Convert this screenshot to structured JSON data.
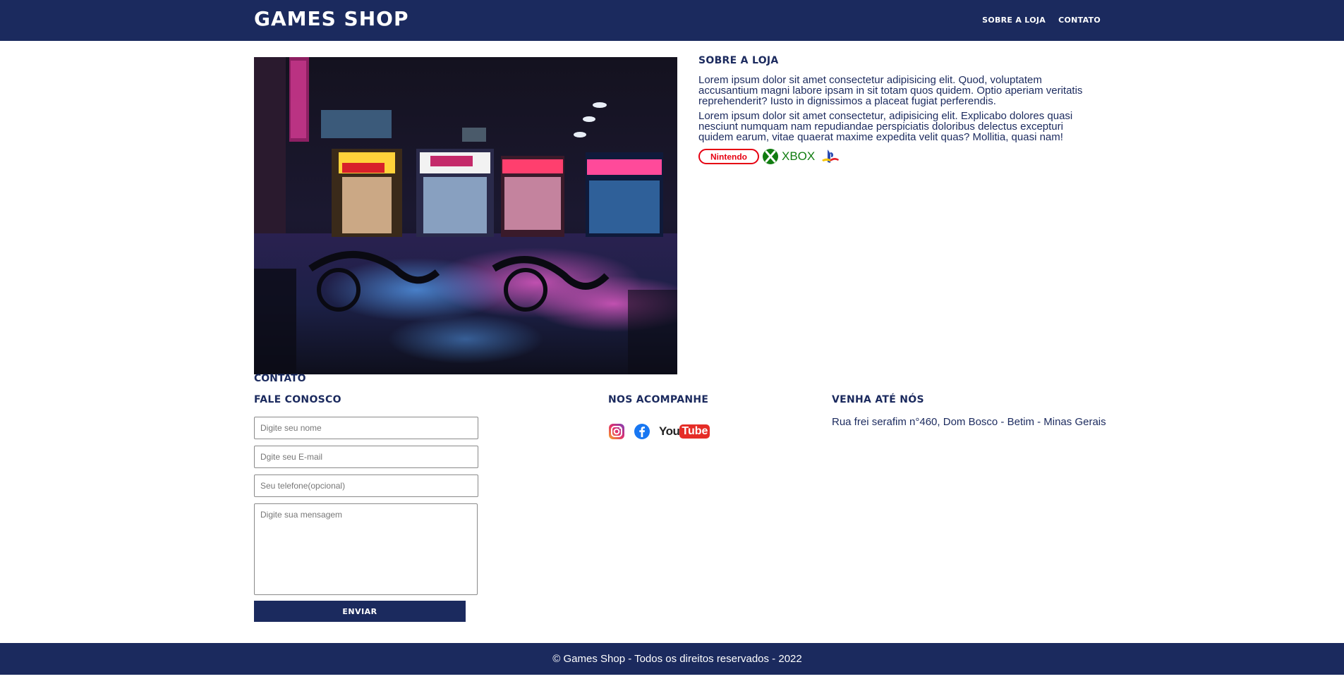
{
  "header": {
    "logo": "GAMES SHOP",
    "nav": [
      "SOBRE A LOJA",
      "CONTATO"
    ]
  },
  "about": {
    "title": "SOBRE A LOJA",
    "paragraphs": [
      "Lorem ipsum dolor sit amet consectetur adipisicing elit. Quod, voluptatem accusantium magni labore ipsam in sit totam quos quidem. Optio aperiam veritatis reprehenderit? Iusto in dignissimos a placeat fugiat perferendis.",
      "Lorem ipsum dolor sit amet consectetur, adipisicing elit. Explicabo dolores quasi nesciunt numquam nam repudiandae perspiciatis doloribus delectus excepturi quidem earum, vitae quaerat maxime expedita velit quas? Mollitia, quasi nam!"
    ],
    "brands": [
      "Nintendo",
      "XBOX"
    ]
  },
  "contact": {
    "section_title": "CONTATO",
    "form": {
      "title": "FALE CONOSCO",
      "name_placeholder": "Digite seu nome",
      "email_placeholder": "Dgite seu E-mail",
      "phone_placeholder": "Seu telefone(opcional)",
      "message_placeholder": "Digite sua mensagem",
      "submit_label": "ENVIAR"
    },
    "social": {
      "title": "NOS ACOMPANHE",
      "icons": [
        "instagram-icon",
        "facebook-icon",
        "youtube-icon"
      ],
      "youtube_text": "YouTube"
    },
    "location": {
      "title": "VENHA ATÉ NÓS",
      "address": "Rua frei serafim n°460, Dom Bosco - Betim - Minas Gerais"
    }
  },
  "footer": {
    "text": "© Games Shop - Todos os direitos reservados - 2022"
  },
  "colors": {
    "brand_navy": "#1b2a5e",
    "nintendo_red": "#e60012",
    "xbox_green": "#107c10",
    "playstation_blue": "#2a4cb2",
    "youtube_red": "#e52d27"
  }
}
